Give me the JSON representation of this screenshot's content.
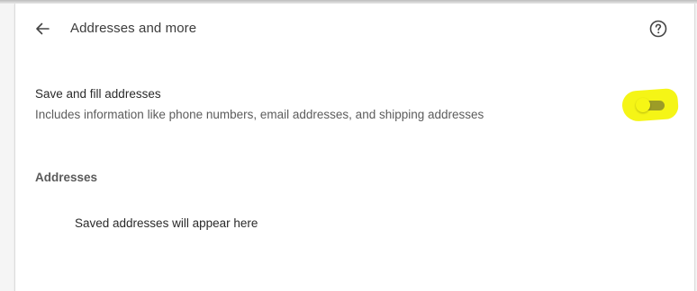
{
  "header": {
    "title": "Addresses and more",
    "back_icon": "arrow-left-icon",
    "help_icon": "help-circle-icon"
  },
  "setting": {
    "label": "Save and fill addresses",
    "description": "Includes information like phone numbers, email addresses, and shipping addresses",
    "toggle_state": "off",
    "highlight_color": "#f4f40a"
  },
  "addresses": {
    "section_title": "Addresses",
    "empty_message": "Saved addresses will appear here"
  }
}
